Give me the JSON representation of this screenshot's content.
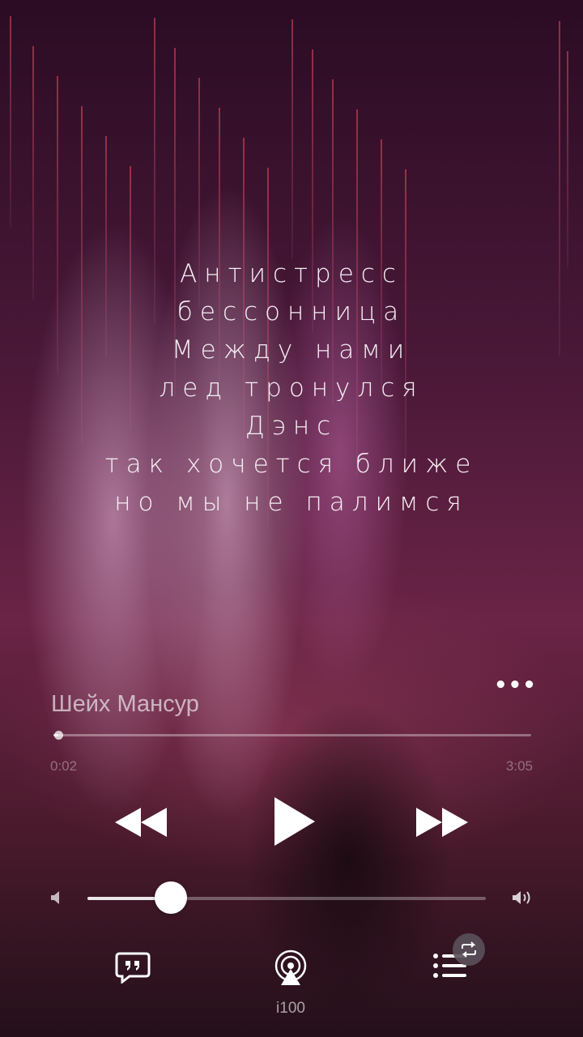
{
  "lyrics": [
    "Антистресс",
    "бессонница",
    "Между нами",
    "лед тронулся",
    "Дэнс",
    "так хочется ближе",
    "но мы не палимся"
  ],
  "track": {
    "title": "Шейх Мансур",
    "elapsed": "0:02",
    "duration": "3:05",
    "progress_fraction": 0.01
  },
  "volume": {
    "level_fraction": 0.21
  },
  "controls": {
    "rewind_icon": "rewind-icon",
    "play_icon": "play-icon",
    "forward_icon": "fast-forward-icon",
    "more_icon": "more-dots-icon"
  },
  "bottom_bar": {
    "lyrics_icon": "lyrics-quote-icon",
    "airplay_icon": "airplay-audio-icon",
    "airplay_label": "i100",
    "queue_icon": "queue-list-icon",
    "repeat_icon": "repeat-icon"
  }
}
